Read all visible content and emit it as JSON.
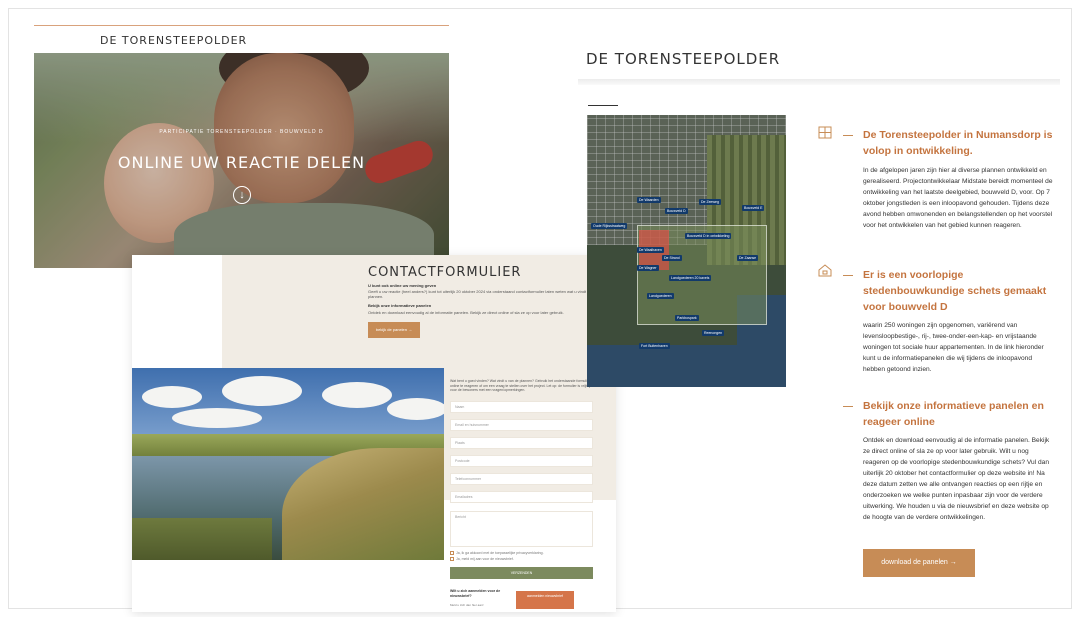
{
  "hero": {
    "brand": "DE TORENSTEEPOLDER",
    "kicker": "PARTICIPATIE TORENSTEEPOLDER · BOUWVELD D",
    "title": "ONLINE UW REACTIE DELEN",
    "arrow_icon": "arrow-down-circle-icon"
  },
  "contact_form": {
    "title": "CONTACTFORMULIER",
    "subtitle_bold": "U kunt ook online uw mening geven",
    "subtitle_text": "Geeft u uw reactie (heel anders?) kunt tot uiterlijk 20 oktober 2024 via onderstaand contactformulier laten weten wat u vindt van de plannen.",
    "panels_heading": "Bekijk onze informatieve panelen",
    "panels_text": "Ontdek en download eenvoudig al de informatie panelen. Bekijk ze direct online of sla ze op voor later gebruik.",
    "panels_button": "bekijk de panelen →",
    "intro": "Wat bent u goed vinden? Wat vindt u van de plannen? Gebruik het onderstaande formulier om online te reageren of om een vraag te stellen over het project. Let op: de formulier is vrijblijvend voor de bewoners met een vragen/opmerkingen.",
    "fields": [
      "Naam",
      "Email en huisnummer",
      "Plaats",
      "Postcode",
      "Telefoonnummer",
      "Emailadres"
    ],
    "textarea_placeholder": "Bericht",
    "checkboxes": [
      "Ja, ik ga akkoord met de toepasselijke privacyverklaring.",
      "Ja, meld mij aan voor de nieuwsbrief."
    ],
    "submit_label": "VERZENDEN",
    "newsletter_title": "Wilt u zich aanmelden voor de nieuwsbrief?",
    "newsletter_sub": "Meld u zich dan hier aan!",
    "newsletter_button": "aanmelden nieuwsbrief"
  },
  "right": {
    "brand": "DE TORENSTEEPOLDER",
    "map_labels": [
      "De Waarden",
      "Bouwveld D",
      "De Zeeweg",
      "Oude Rijksstraatweg",
      "Bouwveld D in ontwikkeling",
      "De Waalhaven",
      "Bouwveld E",
      "De Zaanse",
      "De Wagner",
      "De Strand",
      "Landgoederen 20 kavels",
      "Landgoederen",
      "Parkbospark",
      "Reenongen",
      "Fort Buitenhaven"
    ],
    "sections": [
      {
        "icon": "window-icon",
        "title": "De Torensteepolder in Numansdorp is volop in ontwikkeling.",
        "body": "In de afgelopen jaren zijn hier al diverse plannen ontwikkeld en gerealiseerd. Projectontwikkelaar Midstate bereidt momenteel de ontwikkeling van het laatste deelgebied, bouwveld D, voor. Op 7 oktober jongstleden is een inloopavond gehouden. Tijdens deze avond hebben omwonenden en belangstellenden op  het voorstel voor het ontwikkelen van het gebied kunnen reageren."
      },
      {
        "icon": "house-icon",
        "title": "Er is een voorlopige stedenbouwkundige schets gemaakt voor bouwveld D",
        "body": "waarin 250 woningen zijn opgenomen, variërend van levensloopbestige-, rij-, twee-onder-een-kap- en vrijstaande woningen tot sociale huur appartementen. In de link hieronder kunt u de informatiepanelen die wij tijdens de inloopavond hebben getoond inzien."
      },
      {
        "icon": "",
        "title": "Bekijk onze informatieve panelen en reageer online",
        "body": "Ontdek en download eenvoudig al de informatie panelen. Bekijk ze direct online of sla ze op voor later gebruik. Wilt u nog reageren op de voorlopige stedenbouwkundige schets? Vul dan uiterlijk 20 oktober het contactformulier op deze website in! Na deze datum zetten we alle ontvangen reacties op een rijtje en onderzoeken we welke punten inpasbaar zijn voor de verdere uitwerking. We houden u via de nieuwsbrief en deze website op de hoogte van de verdere ontwikkelingen."
      }
    ],
    "download_button": "download de panelen →"
  }
}
